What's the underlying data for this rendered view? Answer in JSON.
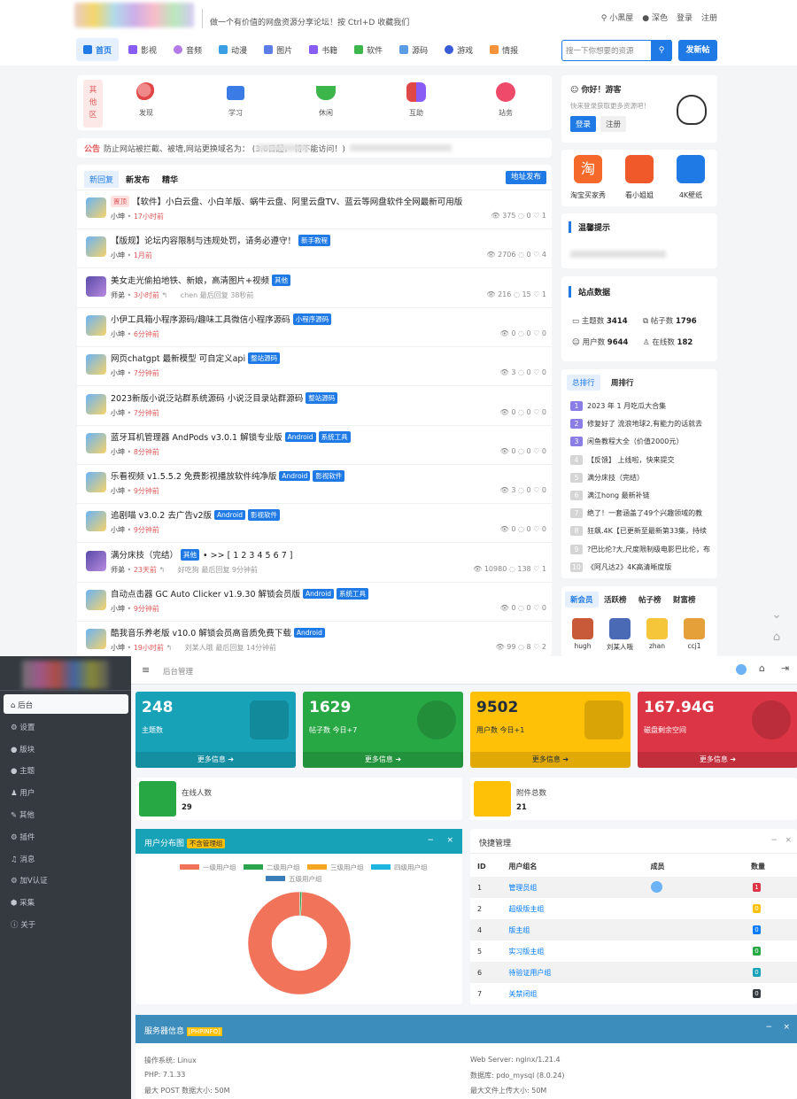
{
  "header": {
    "tagline": "做一个有价值的网盘资源分享论坛！按 Ctrl+D 收藏我们",
    "links": [
      "小黑屋",
      "深色",
      "登录",
      "注册"
    ],
    "nav": [
      "首页",
      "影视",
      "音频",
      "动漫",
      "图片",
      "书籍",
      "软件",
      "源码",
      "游戏",
      "情报"
    ],
    "search_placeholder": "搜一下你想要的资源",
    "post_button": "发新帖"
  },
  "categories": {
    "label": "其他区",
    "items": [
      "发现",
      "学习",
      "休闲",
      "互助",
      "站务"
    ]
  },
  "notice": {
    "label": "公告",
    "text": "防止网站被拦截、被墙,网站更换域名为：              (3.6日起，                         将不能访问！)"
  },
  "list": {
    "tabs": [
      "新回复",
      "新发布",
      "精华"
    ],
    "address_button": "地址发布",
    "posts": [
      {
        "title": "【软件】小白云盘、小白羊版、蜗牛云盘、阿里云盘TV、蓝云等网盘软件全网最新可用版",
        "prefix": "置顶",
        "tags": [],
        "author": "小坤",
        "time": "17小时前",
        "views": "375",
        "replies": "0",
        "likes": "1"
      },
      {
        "title": "【版规】论坛内容限制与违规处罚，请务必遵守！",
        "prefix": "",
        "tags": [
          "新手教程"
        ],
        "author": "小坤",
        "time": "1月前",
        "views": "2706",
        "replies": "0",
        "likes": "4"
      },
      {
        "title": "美女走光偷拍地铁、新娘，高清图片+视频",
        "prefix": "",
        "tags": [
          "其他"
        ],
        "author": "师弟",
        "time": "3小时前",
        "last": "chen  最后回复 38秒前",
        "views": "216",
        "replies": "15",
        "likes": "1"
      },
      {
        "title": "小伊工具箱小程序源码/趣味工具微信小程序源码",
        "prefix": "",
        "tags": [
          "小程序源码"
        ],
        "author": "小坤",
        "time": "6分钟前",
        "views": "0",
        "replies": "0",
        "likes": "0"
      },
      {
        "title": "网页chatgpt 最新模型 可自定义api",
        "prefix": "",
        "tags": [
          "整站源码"
        ],
        "author": "小坤",
        "time": "7分钟前",
        "views": "3",
        "replies": "0",
        "likes": "0"
      },
      {
        "title": "2023新版小说泛站群系统源码 小说泛目录站群源码",
        "prefix": "",
        "tags": [
          "整站源码"
        ],
        "author": "小坤",
        "time": "7分钟前",
        "views": "0",
        "replies": "0",
        "likes": "0"
      },
      {
        "title": "蓝牙耳机管理器 AndPods v3.0.1 解锁专业版",
        "prefix": "",
        "tags": [
          "Android",
          "系统工具"
        ],
        "author": "小坤",
        "time": "8分钟前",
        "views": "0",
        "replies": "0",
        "likes": "0"
      },
      {
        "title": "乐看视频 v1.5.5.2 免费影视播放软件纯净版",
        "prefix": "",
        "tags": [
          "Android",
          "影视软件"
        ],
        "author": "小坤",
        "time": "9分钟前",
        "views": "3",
        "replies": "0",
        "likes": "0"
      },
      {
        "title": "追剧喵 v3.0.2 去广告v2版",
        "prefix": "",
        "tags": [
          "Android",
          "影视软件"
        ],
        "author": "小坤",
        "time": "9分钟前",
        "views": "0",
        "replies": "0",
        "likes": "0"
      },
      {
        "title": "满分床技（完结）",
        "prefix": "",
        "tags": [
          "其他"
        ],
        "suffix": "• >> [ 1 2 3 4 5 6 7 ]",
        "author": "师弟",
        "time": "23天前",
        "last": "好吃狗  最后回复 9分钟前",
        "views": "10980",
        "replies": "138",
        "likes": "1"
      },
      {
        "title": "自动点击器 GC Auto Clicker v1.9.30 解锁会员版",
        "prefix": "",
        "tags": [
          "Android",
          "系统工具"
        ],
        "author": "小坤",
        "time": "9分钟前",
        "views": "0",
        "replies": "0",
        "likes": "0"
      },
      {
        "title": "酷我音乐养老版 v10.0 解锁会员高音质免费下载",
        "prefix": "",
        "tags": [
          "Android"
        ],
        "author": "小坤",
        "time": "19小时前",
        "last": "刘某人哦  最后回复 14分钟前",
        "views": "99",
        "replies": "8",
        "likes": "2"
      }
    ]
  },
  "side": {
    "hello": "你好！游客",
    "hello_sub": "快来登录获取更多资源吧！",
    "login": "登录",
    "register": "注册",
    "apps": [
      "淘宝买家秀",
      "看小姐姐",
      "4K壁纸"
    ],
    "tips_title": "温馨提示",
    "stats_title": "站点数据",
    "stats": [
      {
        "k": "主题数",
        "v": "3414"
      },
      {
        "k": "帖子数",
        "v": "1796"
      },
      {
        "k": "用户数",
        "v": "9644"
      },
      {
        "k": "在线数",
        "v": "182"
      }
    ],
    "rank_tabs": [
      "总排行",
      "周排行"
    ],
    "rank": [
      "2023 年 1 月吃瓜大合集",
      "修复好了 流浪地球2,有能力的话就去",
      "闲鱼教程大全（价值2000元）",
      "【反馈】             上线啦，快来提交",
      "满分床技（完结）",
      "满江hong 最新补链",
      "绝了！一套涵盖了49个兴趣领域的教",
      "狂飙.4K【已更新至最新第33集，持续",
      "?巴比伦?大,尺度限制级电影巴比伦，布",
      "《阿凡达2》4K高清晰度版"
    ],
    "member_tabs": [
      "新会员",
      "活跃榜",
      "帖子榜",
      "财富榜"
    ],
    "members": [
      "hugh",
      "刘某人哦",
      "zhan",
      "ccj1"
    ]
  },
  "admin": {
    "breadcrumb": "后台管理",
    "menu": [
      "后台",
      "设置",
      "版块",
      "主题",
      "用户",
      "其他",
      "插件",
      "消息",
      "加V认证",
      "采集",
      "关于"
    ],
    "boxes": [
      {
        "v": "248",
        "l": "主题数",
        "f": "更多信息 ➔"
      },
      {
        "v": "1629",
        "l": "帖子数 今日+7",
        "f": "更多信息 ➔"
      },
      {
        "v": "9502",
        "l": "用户数 今日+1",
        "f": "更多信息 ➔"
      },
      {
        "v": "167.94G",
        "l": "磁盘剩余空间",
        "f": "更多信息 ➔"
      }
    ],
    "info": [
      {
        "l": "在线人数",
        "v": "29"
      },
      {
        "l": "附件总数",
        "v": "21"
      }
    ],
    "dist_title": "用户分布图",
    "dist_badge": "不含管理组",
    "legend": [
      "一级用户组",
      "二级用户组",
      "三级用户组",
      "四级用户组",
      "五级用户组"
    ],
    "quick_title": "快捷管理",
    "quick_cols": [
      "ID",
      "用户组名",
      "成员",
      "数量"
    ],
    "quick_rows": [
      {
        "id": "1",
        "name": "管理员组",
        "n": "1"
      },
      {
        "id": "2",
        "name": "超级版主组",
        "n": "0"
      },
      {
        "id": "4",
        "name": "版主组",
        "n": "0"
      },
      {
        "id": "5",
        "name": "实习版主组",
        "n": "0"
      },
      {
        "id": "6",
        "name": "待验证用户组",
        "n": "0"
      },
      {
        "id": "7",
        "name": "关禁闭组",
        "n": "0"
      }
    ],
    "server_title": "服务器信息",
    "server_badge": "[PHPINFO]",
    "server": [
      {
        "k": "操作系统:",
        "v": "Linux"
      },
      {
        "k": "Web Server:",
        "v": "nginx/1.21.4"
      },
      {
        "k": "PHP:",
        "v": "7.1.33"
      },
      {
        "k": "数据库:",
        "v": "pdo_mysql (8.0.24)"
      },
      {
        "k": "最大 POST 数据大小:",
        "v": "50M"
      },
      {
        "k": "最大文件上传大小:",
        "v": "50M"
      }
    ]
  },
  "chart_data": {
    "type": "pie",
    "categories": [
      "一级用户组",
      "二级用户组",
      "三级用户组",
      "四级用户组",
      "五级用户组"
    ],
    "values": [
      99.4,
      0.6,
      0,
      0,
      0
    ],
    "colors": [
      "#f0735a",
      "#2da44e",
      "#f5a623",
      "#1fb5e0",
      "#3b7db8"
    ]
  }
}
